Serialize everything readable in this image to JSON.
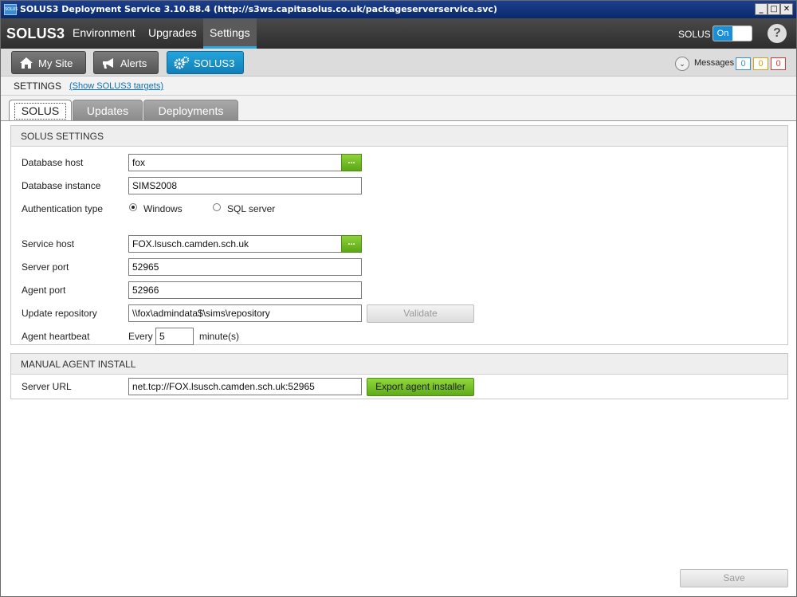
{
  "window": {
    "title": "SOLUS3 Deployment Service 3.10.88.4 (http://s3ws.capitasolus.co.uk/packageserverservice.svc)",
    "icon_text": "SOLUS",
    "controls": [
      "_",
      "□",
      "✕"
    ]
  },
  "topnav": {
    "brand": "SOLUS3",
    "items": [
      {
        "label": "Environment",
        "active": false
      },
      {
        "label": "Upgrades",
        "active": false
      },
      {
        "label": "Settings",
        "active": true
      }
    ],
    "solus_label": "SOLUS",
    "toggle_label": "On",
    "help_icon": "?"
  },
  "subnav": {
    "buttons": [
      {
        "label": "My Site",
        "icon": "home-icon",
        "active": false
      },
      {
        "label": "Alerts",
        "icon": "megaphone-icon",
        "active": false
      },
      {
        "label": "SOLUS3",
        "icon": "gears-icon",
        "active": true
      }
    ],
    "messages_label": "Messages",
    "message_counts": [
      {
        "value": "0",
        "color": "#3a8ed0"
      },
      {
        "value": "0",
        "color": "#d6a21a"
      },
      {
        "value": "0",
        "color": "#d03a3a"
      }
    ]
  },
  "settings_bar": {
    "title": "SETTINGS",
    "link": "(Show SOLUS3 targets)"
  },
  "tabs": [
    {
      "label": "SOLUS",
      "active": true
    },
    {
      "label": "Updates",
      "active": false
    },
    {
      "label": "Deployments",
      "active": false
    }
  ],
  "solus_settings": {
    "header": "SOLUS SETTINGS",
    "database_host_label": "Database host",
    "database_host_value": "fox",
    "browse_label": "...",
    "database_instance_label": "Database instance",
    "database_instance_value": "SIMS2008",
    "auth_label": "Authentication type",
    "auth_options": [
      {
        "label": "Windows",
        "checked": true
      },
      {
        "label": "SQL server",
        "checked": false
      }
    ],
    "service_host_label": "Service host",
    "service_host_value": "FOX.lsusch.camden.sch.uk",
    "server_port_label": "Server port",
    "server_port_value": "52965",
    "agent_port_label": "Agent port",
    "agent_port_value": "52966",
    "update_repo_label": "Update repository",
    "update_repo_value": "\\\\fox\\admindata$\\sims\\repository",
    "validate_label": "Validate",
    "heartbeat_label": "Agent heartbeat",
    "heartbeat_every": "Every",
    "heartbeat_value": "5",
    "heartbeat_unit": "minute(s)"
  },
  "manual_install": {
    "header": "MANUAL AGENT INSTALL",
    "server_url_label": "Server URL",
    "server_url_value": "net.tcp://FOX.lsusch.camden.sch.uk:52965",
    "export_label": "Export agent installer"
  },
  "footer": {
    "save_label": "Save"
  }
}
